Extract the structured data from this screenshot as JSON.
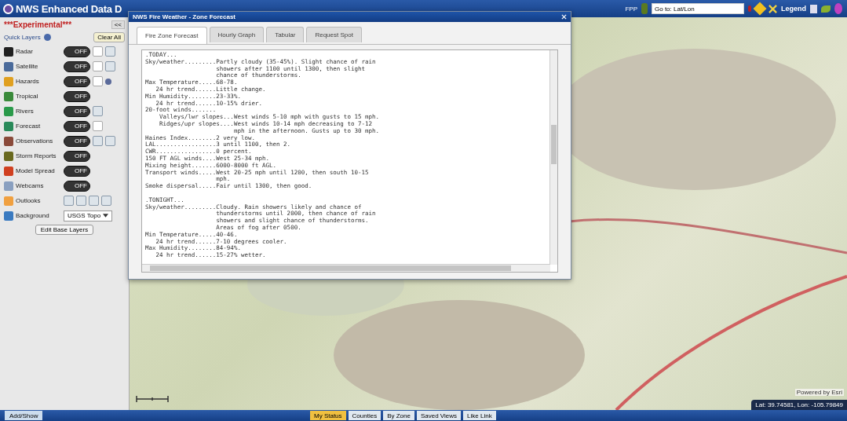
{
  "header": {
    "title": "NWS Enhanced Data D",
    "tools": [
      {
        "label": "FPP"
      }
    ],
    "search": {
      "value": "Go to: Lat/Lon"
    },
    "legend": "Legend"
  },
  "sidebar": {
    "experimental": "***Experimental***",
    "collapse": "<<",
    "quick_layers": "Quick Layers",
    "clear_all": "Clear All",
    "layers": [
      {
        "name": "Radar",
        "color": "#202020",
        "toggle": "OFF",
        "on": false,
        "option_icons": [
          {
            "kind": "box"
          },
          {
            "kind": "button"
          }
        ]
      },
      {
        "name": "Satellite",
        "color": "#4a6a9a",
        "toggle": "OFF",
        "on": false,
        "option_icons": [
          {
            "kind": "box"
          },
          {
            "kind": "button"
          }
        ]
      },
      {
        "name": "Hazards",
        "color": "#e0a020",
        "toggle": "OFF",
        "on": false,
        "option_icons": [
          {
            "kind": "box"
          },
          {
            "kind": "dot"
          }
        ]
      },
      {
        "name": "Tropical",
        "color": "#3a8a3a",
        "toggle": "OFF",
        "on": false
      },
      {
        "name": "Rivers",
        "color": "#2a9a4a",
        "toggle": "OFF",
        "on": false,
        "option_icons": [
          {
            "kind": "button"
          }
        ]
      },
      {
        "name": "Forecast",
        "color": "#2a8a5a",
        "toggle": "OFF",
        "on": false,
        "option_icons": [
          {
            "kind": "box"
          }
        ]
      },
      {
        "name": "Observations",
        "color": "#8a4a3a",
        "toggle": "OFF",
        "on": false,
        "option_icons": [
          {
            "kind": "button"
          },
          {
            "kind": "button"
          }
        ]
      },
      {
        "name": "Storm Reports",
        "color": "#6a6a20",
        "toggle": "OFF",
        "on": false
      },
      {
        "name": "Model Spread",
        "color": "#d04020",
        "toggle": "OFF",
        "on": false
      },
      {
        "name": "Webcams",
        "color": "#8aa0c0",
        "toggle": "OFF",
        "on": false
      },
      {
        "name": "Outlooks",
        "color": "#f0a040",
        "option_icons": [
          {
            "kind": "button"
          },
          {
            "kind": "button"
          },
          {
            "kind": "button"
          },
          {
            "kind": "button"
          }
        ]
      }
    ],
    "background": {
      "label": "Background",
      "value": "USGS Topo"
    },
    "edit_button": "Edit Base Layers"
  },
  "dialog": {
    "title": "NWS Fire Weather - Zone Forecast",
    "tabs": [
      {
        "label": "Fire Zone Forecast",
        "selected": true
      },
      {
        "label": "Hourly Graph",
        "selected": false
      },
      {
        "label": "Tabular",
        "selected": false
      },
      {
        "label": "Request Spot",
        "selected": false
      }
    ],
    "forecast_sections": [
      {
        "lines": [
          ".TODAY...",
          "Sky/weather.........Partly cloudy (35-45%). Slight chance of rain",
          "                    showers after 1100 until 1300, then slight",
          "                    chance of thunderstorms.",
          "Max Temperature.....68-78.",
          "   24 hr trend......Little change.",
          "Min Humidity........23-33%.",
          "   24 hr trend......10-15% drier.",
          "20-foot winds.......",
          "    Valleys/lwr slopes...West winds 5-10 mph with gusts to 15 mph.",
          "    Ridges/upr slopes....West winds 10-14 mph decreasing to 7-12",
          "                         mph in the afternoon. Gusts up to 30 mph.",
          "Haines Index........2 very low.",
          "LAL.................3 until 1100, then 2.",
          "CWR.................0 percent.",
          "150 FT AGL winds....West 25-34 mph.",
          "Mixing height.......6000-8000 ft AGL.",
          "Transport winds.....West 20-25 mph until 1200, then south 10-15",
          "                    mph.",
          "Smoke dispersal.....Fair until 1300, then good."
        ]
      },
      {
        "lines": [
          ".TONIGHT...",
          "Sky/weather.........Cloudy. Rain showers likely and chance of",
          "                    thunderstorms until 2000, then chance of rain",
          "                    showers and slight chance of thunderstorms.",
          "                    Areas of fog after 0500.",
          "Min Temperature.....40-46.",
          "   24 hr trend......7-10 degrees cooler.",
          "Max Humidity........84-94%.",
          "   24 hr trend......15-27% wetter."
        ]
      }
    ]
  },
  "map": {
    "coordinates": "Lat: 39.74581, Lon: -105.79849",
    "attribution": "Powered by Esri"
  },
  "bottom_bar": {
    "left_button": "Add/Show",
    "buttons": [
      {
        "label": "My Status"
      },
      {
        "label": "Counties"
      },
      {
        "label": "By Zone"
      },
      {
        "label": "Saved Views"
      },
      {
        "label": "Like Link"
      }
    ]
  }
}
